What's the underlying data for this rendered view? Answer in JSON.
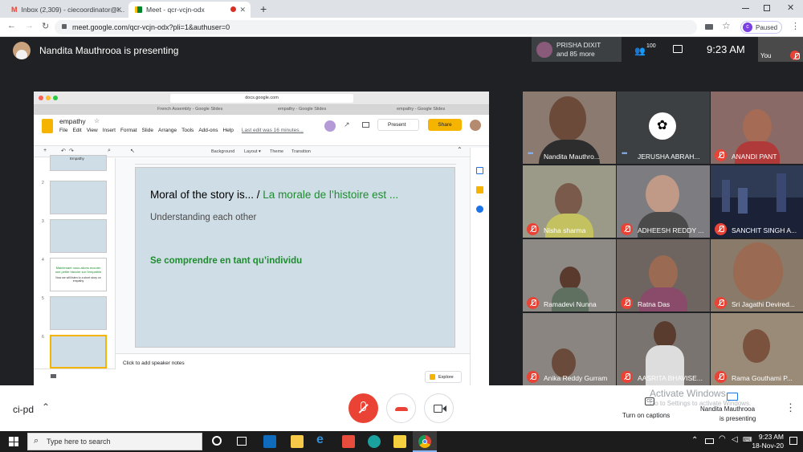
{
  "browser": {
    "tabs": [
      {
        "title": "Inbox (2,309) - ciecoordinator@i..."
      },
      {
        "title": "Meet - qcr-vcjn-odx"
      }
    ],
    "new_tab_label": "+",
    "url": "meet.google.com/qcr-vcjn-odx?pli=1&authuser=0",
    "profile_status": "Paused",
    "profile_initial": "c"
  },
  "meet": {
    "presenter_banner": "Nandita Mauthrooa is presenting",
    "top_tile_name": "PRISHA DIXIT",
    "top_tile_more": "and 85 more",
    "participant_count": "100",
    "clock": "9:23 AM",
    "self_label": "You",
    "meeting_code": "ci-pd",
    "captions_label": "Turn on captions",
    "presenting_name": "Nandita Mauthrooa",
    "presenting_sub": "is presenting",
    "watermark_title": "Activate Windows",
    "watermark_sub": "Go to Settings to activate Windows."
  },
  "participants": [
    {
      "name": "Nandita Mauthro...",
      "muted": false
    },
    {
      "name": "JERUSHA ABRAH...",
      "muted": false
    },
    {
      "name": "ANANDI PANT",
      "muted": true
    },
    {
      "name": "Nisha sharma",
      "muted": true
    },
    {
      "name": "ADHEESH REDDY ...",
      "muted": true
    },
    {
      "name": "SANCHIT SINGH A...",
      "muted": true
    },
    {
      "name": "Ramadevi Nunna",
      "muted": true
    },
    {
      "name": "Ratna Das",
      "muted": true
    },
    {
      "name": "Sri Jagathi Devired...",
      "muted": true
    },
    {
      "name": "Anika Reddy Gurram",
      "muted": true
    },
    {
      "name": "AASRITA BHAVISE...",
      "muted": true
    },
    {
      "name": "Rama Gouthami P...",
      "muted": true
    }
  ],
  "shared": {
    "mac_url": "docs.google.com",
    "inner_tabs": [
      "French Assembly - Google Slides",
      "empathy - Google Slides",
      "empathy - Google Slides"
    ],
    "doc_title": "empathy",
    "menus": [
      "File",
      "Edit",
      "View",
      "Insert",
      "Format",
      "Slide",
      "Arrange",
      "Tools",
      "Add-ons",
      "Help"
    ],
    "last_edit": "Last edit was 16 minutes...",
    "present_label": "Present",
    "share_label": "Share",
    "toolbar_items": [
      "Background",
      "Layout ▾",
      "Theme",
      "Transition"
    ],
    "slide_numbers": [
      "2",
      "3",
      "4",
      "5",
      "6"
    ],
    "thumb4_title": "Maintenant nous allons écouter une petite histoire sur l'empathie",
    "thumb4_sub": "Now we will listen to a short story on empathy",
    "thumb_top_title": "Empathy",
    "slide": {
      "title_en": "Moral of the story is... / ",
      "title_fr": "La morale de l’histoire est ...",
      "subtitle": "Understanding each other",
      "body_fr": "Se comprendre en tant qu’individu"
    },
    "speaker_notes": "Click to add speaker notes",
    "explore_label": "Explore"
  },
  "taskbar": {
    "search_placeholder": "Type here to search",
    "time": "9:23 AM",
    "date": "18-Nov-20"
  },
  "colors": {
    "meet_bg": "#202124",
    "end_call": "#ea4335",
    "slide_bg": "#cfdde6",
    "french_green": "#1e8c2e",
    "share_yellow": "#f4b400"
  }
}
